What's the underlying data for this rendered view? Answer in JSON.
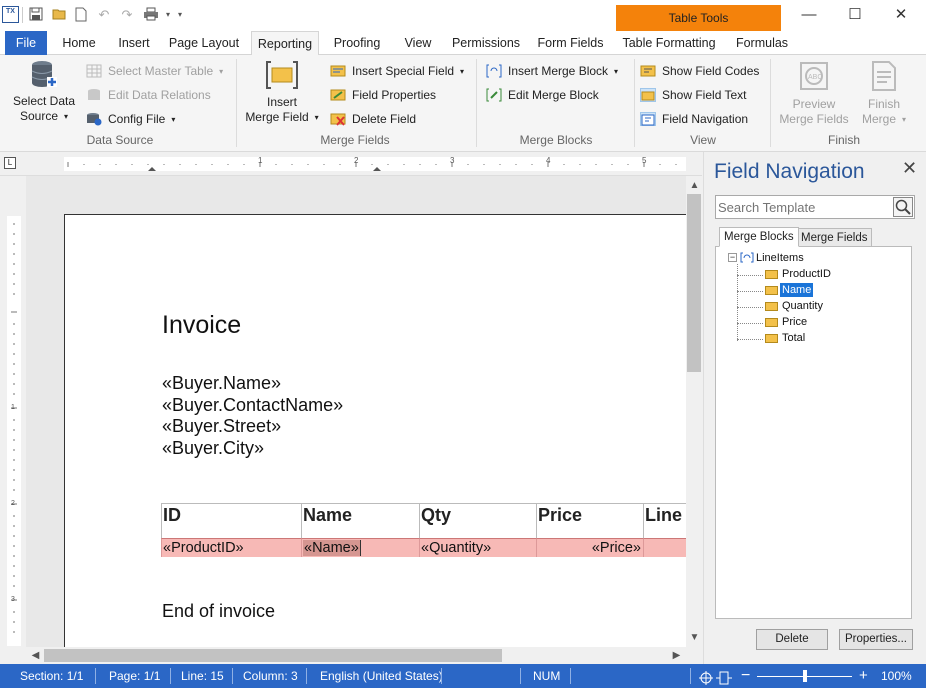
{
  "titlebar": {
    "logo_text": "TX",
    "context_tab": "Table Tools",
    "accent_color": "#f4820b",
    "minimize": "—",
    "maximize": "☐",
    "close": "✕"
  },
  "tabs": {
    "file": "File",
    "items": [
      "Home",
      "Insert",
      "Page Layout",
      "Reporting",
      "Proofing",
      "View",
      "Permissions",
      "Form Fields",
      "Table Formatting",
      "Formulas"
    ],
    "active": "Reporting"
  },
  "ribbon": {
    "data_source": {
      "select_data_source": "Select Data",
      "select_data_source_2": "Source",
      "select_master_table": "Select Master Table",
      "edit_data_relations": "Edit Data Relations",
      "config_file": "Config File",
      "group_label": "Data Source"
    },
    "merge_fields": {
      "insert_merge_field": "Insert",
      "insert_merge_field_2": "Merge Field",
      "insert_special_field": "Insert Special Field",
      "field_properties": "Field Properties",
      "delete_field": "Delete Field",
      "group_label": "Merge Fields"
    },
    "merge_blocks": {
      "insert_merge_block": "Insert Merge Block",
      "edit_merge_block": "Edit Merge Block",
      "group_label": "Merge Blocks"
    },
    "view": {
      "show_field_codes": "Show Field Codes",
      "show_field_text": "Show Field Text",
      "field_navigation": "Field Navigation",
      "group_label": "View"
    },
    "finish": {
      "preview": "Preview",
      "preview_2": "Merge Fields",
      "finish_merge": "Finish",
      "finish_merge_2": "Merge",
      "group_label": "Finish"
    }
  },
  "document": {
    "title": "Invoice",
    "buyer_lines": [
      "«Buyer.Name»",
      "«Buyer.ContactName»",
      "«Buyer.Street»",
      "«Buyer.City»"
    ],
    "table_headers": [
      "ID",
      "Name",
      "Qty",
      "Price",
      "Line"
    ],
    "table_row": [
      "«ProductID»",
      "«Name»",
      "«Quantity»",
      "«Price»",
      ""
    ],
    "footer": "End of invoice",
    "field_highlight_color": "#f7b9b6"
  },
  "panel": {
    "title": "Field Navigation",
    "search_placeholder": "Search Template",
    "tabs": [
      "Merge Blocks",
      "Merge Fields"
    ],
    "tree_root": "LineItems",
    "tree_children": [
      "ProductID",
      "Name",
      "Quantity",
      "Price",
      "Total"
    ],
    "selected": "Name",
    "delete_button": "Delete",
    "properties_button": "Properties..."
  },
  "statusbar": {
    "section": "Section: 1/1",
    "page": "Page: 1/1",
    "line": "Line: 15",
    "column": "Column: 3",
    "language": "English (United States)",
    "num": "NUM",
    "zoom": "100%",
    "zoom_fraction": 0.5
  }
}
